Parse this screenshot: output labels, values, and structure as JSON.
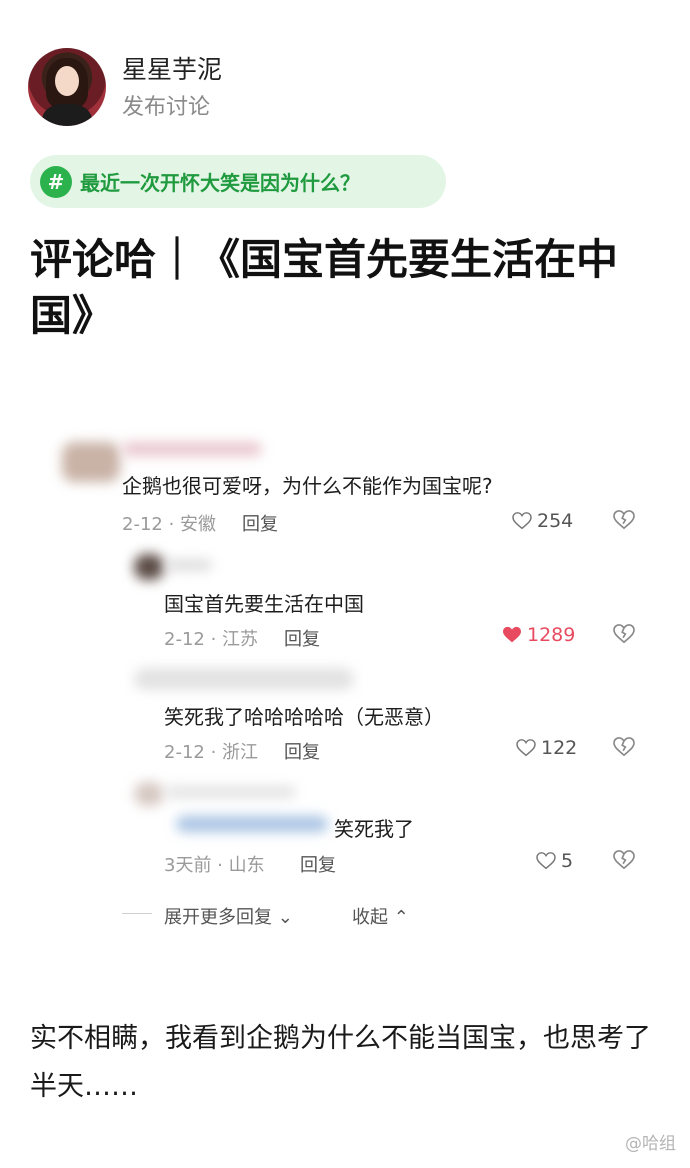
{
  "post": {
    "author": "星星芋泥",
    "action": "发布讨论",
    "topic": "最近一次开怀大笑是因为什么？",
    "topic_icon": "#",
    "headline": "评论哈｜《国宝首先要生活在中国》",
    "footer": "实不相瞒，我看到企鹅为什么不能当国宝，也思考了半天……"
  },
  "comments": [
    {
      "text": "企鹅也很可爱呀，为什么不能作为国宝呢?",
      "meta": "2-12 · 安徽",
      "reply": "回复",
      "likes": "254",
      "liked": false
    },
    {
      "text": "国宝首先要生活在中国",
      "meta": "2-12 · 江苏",
      "reply": "回复",
      "likes": "1289",
      "liked": true
    },
    {
      "text": "笑死我了哈哈哈哈哈（无恶意）",
      "meta": "2-12 · 浙江",
      "reply": "回复",
      "likes": "122",
      "liked": false
    },
    {
      "text": "笑死我了",
      "meta": "3天前 · 山东",
      "reply": "回复",
      "likes": "5",
      "liked": false
    }
  ],
  "thread": {
    "expand": "展开更多回复",
    "collapse": "收起"
  },
  "watermark": "@哈组",
  "colors": {
    "topic_green": "#2bb24c",
    "liked_red": "#e84a5f"
  }
}
